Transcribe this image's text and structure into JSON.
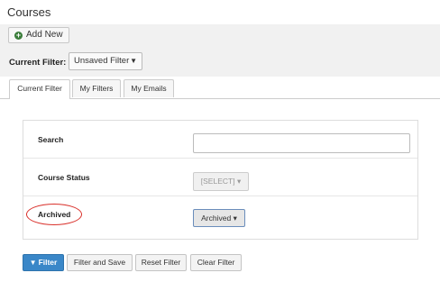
{
  "page": {
    "title": "Courses"
  },
  "toolbar": {
    "add_new_label": "Add New",
    "current_filter_label": "Current Filter:",
    "filter_select_value": "Unsaved Filter",
    "caret": "▼"
  },
  "tabs": [
    {
      "label": "Current Filter",
      "active": true
    },
    {
      "label": "My Filters",
      "active": false
    },
    {
      "label": "My Emails",
      "active": false
    }
  ],
  "filters": {
    "search_label": "Search",
    "search_value": "",
    "status_label": "Course Status",
    "status_value": "[SELECT]",
    "archived_label": "Archived",
    "archived_value": "Archived",
    "dropdown_caret": "▾"
  },
  "actions": {
    "filter_label": "Filter",
    "filter_save_label": "Filter and Save",
    "reset_label": "Reset Filter",
    "clear_label": "Clear Filter"
  },
  "colors": {
    "primary_button": "#3a87c8",
    "highlight_oval": "#d9302a",
    "add_icon": "#3a7d3a"
  },
  "icons": {
    "add": "plus-circle-icon",
    "filter": "funnel-icon"
  }
}
